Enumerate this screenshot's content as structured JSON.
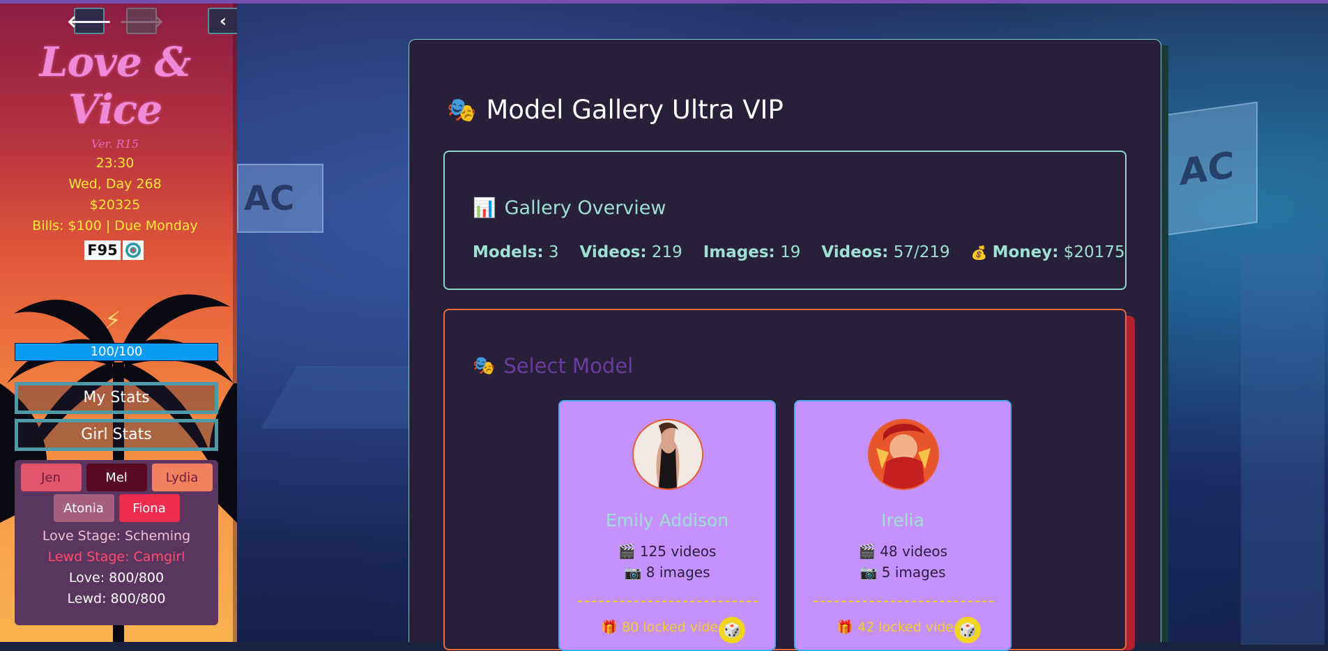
{
  "game": {
    "logo": "Love & Vice",
    "version": "Ver. R15",
    "time": "23:30",
    "date": "Wed, Day 268",
    "cash": "$20325",
    "bills": "Bills: $100 | Due Monday",
    "badge": "F95"
  },
  "nav": {
    "back_icon": "arrow-left-icon",
    "forward_icon": "arrow-right-icon",
    "collapse_icon": "chevron-left-icon"
  },
  "energy": {
    "value": 100,
    "max": 100,
    "label": "100/100",
    "fill_fraction": 1.0
  },
  "buttons": {
    "my_stats": "My Stats",
    "girl_stats": "Girl Stats"
  },
  "girls": [
    {
      "name": "Jen",
      "bg": "#e2556c",
      "fg": "#6a1f3a"
    },
    {
      "name": "Mel",
      "bg": "#5a0b24",
      "fg": "#ffffff"
    },
    {
      "name": "Lydia",
      "bg": "#f28060",
      "fg": "#6a1f3a"
    },
    {
      "name": "Atonia",
      "bg": "#a5607e",
      "fg": "#ffffff"
    },
    {
      "name": "Fiona",
      "bg": "#ee2d4e",
      "fg": "#ffffff"
    }
  ],
  "girl_info": {
    "love_stage": "Love Stage: Scheming",
    "lewd_stage": "Lewd Stage: Camgirl",
    "love": "Love: 800/800",
    "lewd": "Lewd: 800/800"
  },
  "page": {
    "title": "Model Gallery Ultra VIP",
    "title_icon": "theater-masks-icon"
  },
  "overview": {
    "title": "Gallery Overview",
    "title_icon": "bar-chart-icon",
    "models_label": "Models:",
    "models_value": "3",
    "videos_label": "Videos:",
    "videos_value": "219",
    "images_label": "Images:",
    "images_value": "19",
    "videos2_label": "Videos:",
    "videos2_value": "57/219",
    "money_icon": "money-bag-icon",
    "money_label": "Money:",
    "money_value": "$20175"
  },
  "select": {
    "title": "Select Model",
    "title_icon": "theater-masks-icon"
  },
  "models": [
    {
      "name": "Emily Addison",
      "videos": "125 videos",
      "images": "8 images",
      "locked": "80 locked videos"
    },
    {
      "name": "Irelia",
      "videos": "48 videos",
      "images": "5 images",
      "locked": "42 locked videos"
    }
  ]
}
